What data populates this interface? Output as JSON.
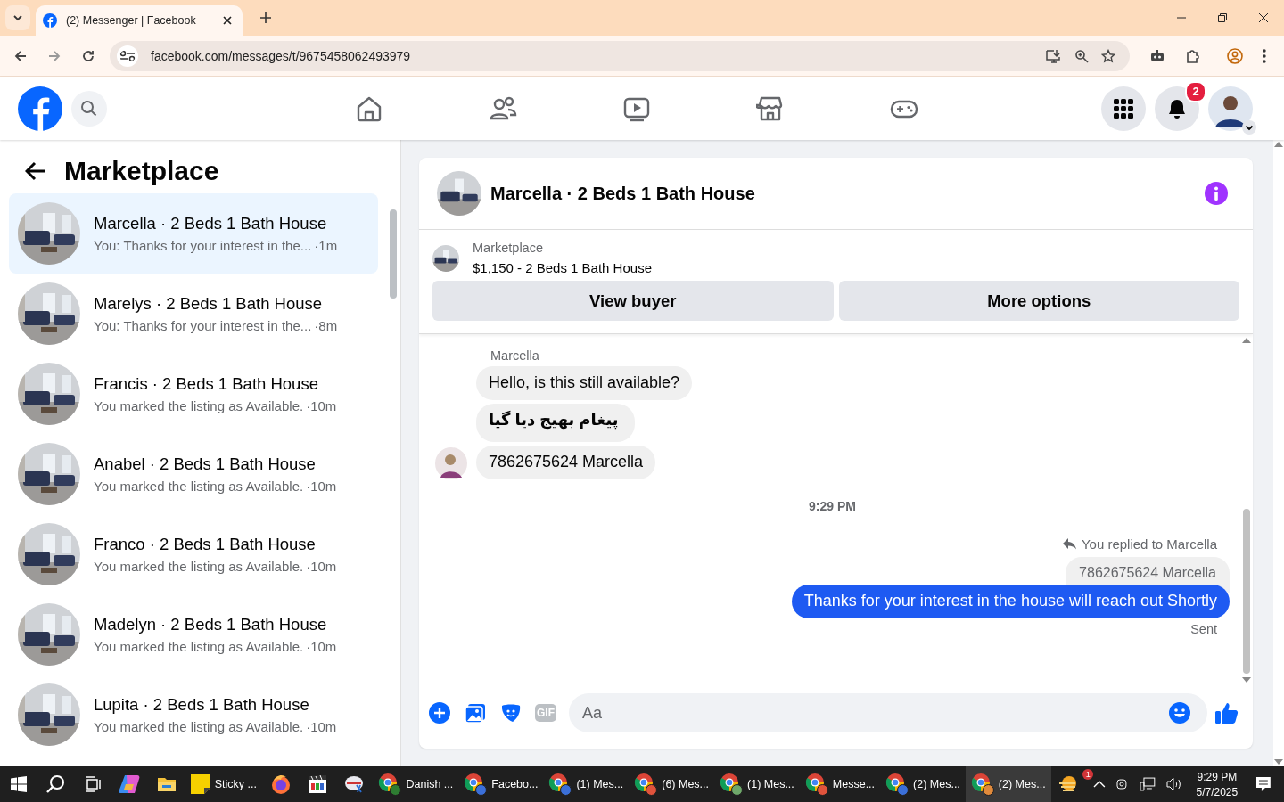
{
  "browser": {
    "tab_title": "(2) Messenger | Facebook",
    "url": "facebook.com/messages/t/9675458062493979"
  },
  "header": {
    "notification_count": "2"
  },
  "sidebar": {
    "title": "Marketplace",
    "chats": [
      {
        "name": "Marcella · 2 Beds 1 Bath House",
        "preview": "You: Thanks for your interest in the...",
        "time": "·1m",
        "selected": true
      },
      {
        "name": "Marelys · 2 Beds 1 Bath House",
        "preview": "You: Thanks for your interest in the...",
        "time": "·8m",
        "selected": false
      },
      {
        "name": "Francis · 2 Beds 1 Bath House",
        "preview": "You marked the listing as Available.",
        "time": "·10m",
        "selected": false
      },
      {
        "name": "Anabel · 2 Beds 1 Bath House",
        "preview": "You marked the listing as Available.",
        "time": "·10m",
        "selected": false
      },
      {
        "name": "Franco · 2 Beds 1 Bath House",
        "preview": "You marked the listing as Available.",
        "time": "·10m",
        "selected": false
      },
      {
        "name": "Madelyn · 2 Beds 1 Bath House",
        "preview": "You marked the listing as Available.",
        "time": "·10m",
        "selected": false
      },
      {
        "name": "Lupita · 2 Beds 1 Bath House",
        "preview": "You marked the listing as Available.",
        "time": "·10m",
        "selected": false
      }
    ]
  },
  "conversation": {
    "title": "Marcella · 2 Beds 1 Bath House",
    "listing": {
      "label": "Marketplace",
      "detail": "$1,150 - 2 Beds 1 Bath House"
    },
    "buttons": [
      "View buyer",
      "More options"
    ],
    "messages": [
      {
        "kind": "sender",
        "text": "Marcella"
      },
      {
        "kind": "in",
        "text": "Hello, is this still available?",
        "avatar": false
      },
      {
        "kind": "in",
        "text": "پیغام بھیج دیا گیا",
        "avatar": false
      },
      {
        "kind": "in",
        "text": "7862675624 Marcella",
        "avatar": true
      },
      {
        "kind": "time",
        "text": "9:29 PM"
      },
      {
        "kind": "reply_note",
        "text": "You replied to Marcella"
      },
      {
        "kind": "quoted",
        "text": "7862675624 Marcella"
      },
      {
        "kind": "out",
        "text": "Thanks for your interest in the house will reach out Shortly"
      },
      {
        "kind": "status",
        "text": "Sent"
      }
    ],
    "composer": {
      "placeholder": "Aa",
      "gif_label": "GIF"
    }
  },
  "taskbar": {
    "apps": [
      {
        "kind": "start"
      },
      {
        "kind": "search"
      },
      {
        "kind": "taskview"
      },
      {
        "kind": "copilot"
      },
      {
        "kind": "folder"
      },
      {
        "kind": "sticky",
        "label": "Sticky ..."
      },
      {
        "kind": "firefox"
      },
      {
        "kind": "media"
      },
      {
        "kind": "snip"
      },
      {
        "kind": "chrome",
        "label": "Danish ...",
        "color": "#2e7d32",
        "selected": false
      },
      {
        "kind": "chrome",
        "label": "Facebo...",
        "color": "#3b6fd8",
        "selected": false
      },
      {
        "kind": "chrome",
        "label": "(1) Mes...",
        "color": "#3b6fd8",
        "selected": false
      },
      {
        "kind": "chrome",
        "label": "(6) Mes...",
        "color": "#e0533c",
        "selected": false
      },
      {
        "kind": "chrome",
        "label": "(1) Mes...",
        "color": "#6fa86a",
        "selected": false
      },
      {
        "kind": "chrome",
        "label": "Messe...",
        "color": "#e0533c",
        "selected": false
      },
      {
        "kind": "chrome",
        "label": "(2) Mes...",
        "color": "#3b6fd8",
        "selected": false
      },
      {
        "kind": "chrome",
        "label": "(2) Mes...",
        "color": "#e08a3c",
        "selected": true
      }
    ],
    "weather_badge": "1",
    "time": "9:29 PM",
    "date": "5/7/2025"
  }
}
